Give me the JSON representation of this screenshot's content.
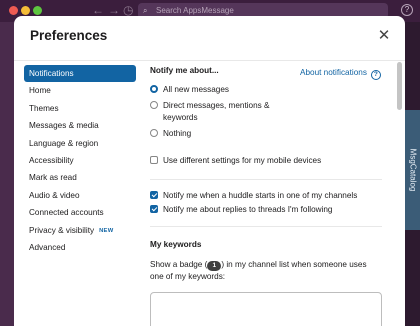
{
  "background": {
    "search_placeholder": "Search AppsMessage",
    "help_icon": "?",
    "side_tab_label": "MsgCatalog"
  },
  "modal": {
    "title": "Preferences",
    "close_glyph": "✕"
  },
  "nav": {
    "items": [
      {
        "label": "Notifications",
        "active": true
      },
      {
        "label": "Home"
      },
      {
        "label": "Themes"
      },
      {
        "label": "Messages & media"
      },
      {
        "label": "Language & region"
      },
      {
        "label": "Accessibility"
      },
      {
        "label": "Mark as read"
      },
      {
        "label": "Audio & video"
      },
      {
        "label": "Connected accounts"
      },
      {
        "label": "Privacy & visibility",
        "badge": "NEW"
      },
      {
        "label": "Advanced"
      }
    ]
  },
  "notifications": {
    "heading": "Notify me about...",
    "about_link": "About notifications",
    "radio_options": [
      {
        "label": "All new messages",
        "selected": true
      },
      {
        "label": "Direct messages, mentions & keywords",
        "selected": false
      },
      {
        "label": "Nothing",
        "selected": false
      }
    ],
    "mobile_settings": {
      "label": "Use different settings for my mobile devices",
      "checked": false
    },
    "huddle": {
      "label": "Notify me when a huddle starts in one of my channels",
      "checked": true
    },
    "threads": {
      "label": "Notify me about replies to threads I'm following",
      "checked": true
    }
  },
  "keywords": {
    "heading": "My keywords",
    "desc_before": "Show a badge (",
    "badge_value": "1",
    "desc_after": ") in my channel list when someone uses one of my keywords:",
    "input_value": ""
  },
  "colors": {
    "accent": "#1264a3",
    "aubergine": "#3b1e3d"
  }
}
